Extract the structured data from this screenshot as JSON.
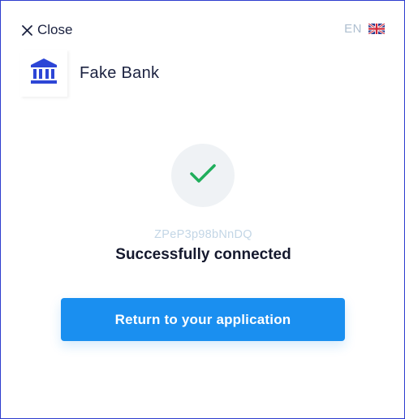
{
  "header": {
    "close_label": "Close",
    "close_icon": "close-icon",
    "language_code": "EN",
    "language_flag_icon": "uk-flag-icon"
  },
  "institution": {
    "name": "Fake Bank",
    "logo_icon": "bank-building-icon",
    "logo_color": "#2d46d6"
  },
  "result": {
    "status_icon": "checkmark-icon",
    "status_icon_color": "#1fae5b",
    "reference_code": "ZPeP3p98bNnDQ",
    "status_message": "Successfully connected"
  },
  "actions": {
    "return_label": "Return to your application",
    "return_color": "#1a8ff0"
  }
}
